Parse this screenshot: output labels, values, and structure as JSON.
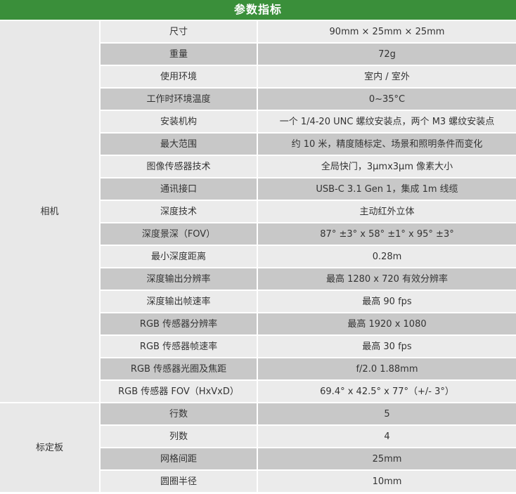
{
  "title": "参数指标",
  "groups": [
    {
      "label": "相机",
      "rows": [
        {
          "name": "尺寸",
          "value": "90mm × 25mm × 25mm"
        },
        {
          "name": "重量",
          "value": "72g"
        },
        {
          "name": "使用环境",
          "value": "室内 / 室外"
        },
        {
          "name": "工作时环境温度",
          "value": "0~35°C"
        },
        {
          "name": "安装机构",
          "value": "一个 1/4-20 UNC 螺纹安装点，两个 M3 螺纹安装点"
        },
        {
          "name": "最大范围",
          "value": "约 10 米，精度随标定、场景和照明条件而变化"
        },
        {
          "name": "图像传感器技术",
          "value": "全局快门，3μmx3μm 像素大小"
        },
        {
          "name": "通讯接口",
          "value": "USB-C 3.1 Gen 1，集成 1m 线缆"
        },
        {
          "name": "深度技术",
          "value": "主动红外立体"
        },
        {
          "name": "深度景深（FOV）",
          "value": "87° ±3° x 58° ±1° x 95° ±3°"
        },
        {
          "name": "最小深度距离",
          "value": "0.28m"
        },
        {
          "name": "深度输出分辨率",
          "value": "最高 1280 x 720 有效分辨率"
        },
        {
          "name": "深度输出帧速率",
          "value": "最高 90 fps"
        },
        {
          "name": "RGB 传感器分辨率",
          "value": "最高 1920 x 1080"
        },
        {
          "name": "RGB 传感器帧速率",
          "value": "最高 30 fps"
        },
        {
          "name": "RGB 传感器光圈及焦距",
          "value": "f/2.0 1.88mm"
        },
        {
          "name": "RGB 传感器 FOV（HxVxD）",
          "value": "69.4° x 42.5° x 77°（+/- 3°）"
        }
      ]
    },
    {
      "label": "标定板",
      "rows": [
        {
          "name": "行数",
          "value": "5"
        },
        {
          "name": "列数",
          "value": "4"
        },
        {
          "name": "网格间距",
          "value": "25mm"
        },
        {
          "name": "圆圈半径",
          "value": "10mm"
        }
      ]
    }
  ]
}
